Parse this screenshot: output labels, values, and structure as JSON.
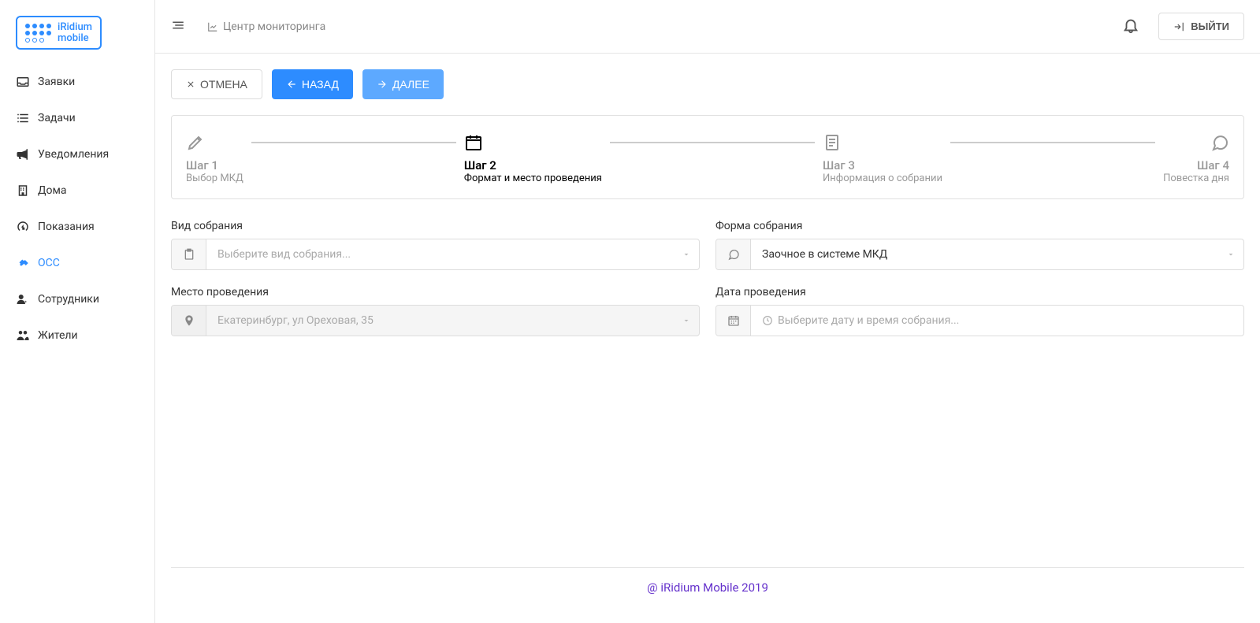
{
  "brand": {
    "line1": "iRidium",
    "line2": "mobile"
  },
  "topbar": {
    "monitoring": "Центр мониторинга",
    "logout": "ВЫЙТИ"
  },
  "sidebar": {
    "items": [
      {
        "label": "Заявки"
      },
      {
        "label": "Задачи"
      },
      {
        "label": "Уведомления"
      },
      {
        "label": "Дома"
      },
      {
        "label": "Показания"
      },
      {
        "label": "ОСС"
      },
      {
        "label": "Сотрудники"
      },
      {
        "label": "Жители"
      }
    ]
  },
  "actions": {
    "cancel": "ОТМЕНА",
    "back": "НАЗАД",
    "next": "ДАЛЕЕ"
  },
  "wizard": {
    "steps": [
      {
        "title": "Шаг 1",
        "sub": "Выбор МКД"
      },
      {
        "title": "Шаг 2",
        "sub": "Формат и место проведения"
      },
      {
        "title": "Шаг 3",
        "sub": "Информация о собрании"
      },
      {
        "title": "Шаг 4",
        "sub": "Повестка дня"
      }
    ]
  },
  "form": {
    "meeting_type_label": "Вид собрания",
    "meeting_type_placeholder": "Выберите вид собрания...",
    "meeting_form_label": "Форма собрания",
    "meeting_form_value": "Заочное в системе МКД",
    "location_label": "Место проведения",
    "location_value": "Екатеринбург, ул Ореховая, 35",
    "date_label": "Дата проведения",
    "date_placeholder": "Выберите дату и время собрания..."
  },
  "footer": "@ iRidium Mobile 2019"
}
